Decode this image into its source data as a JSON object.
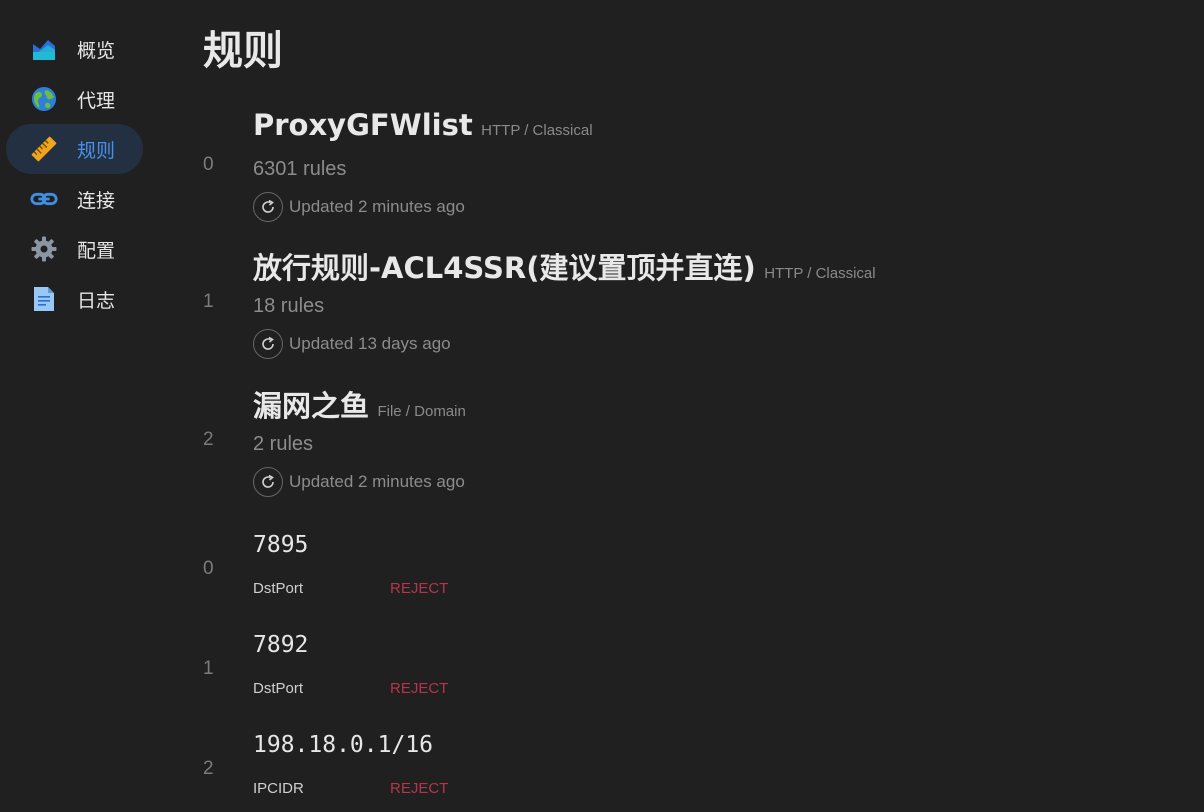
{
  "sidebar": {
    "items": [
      {
        "label": "概览",
        "icon": "overview-chart-icon",
        "active": false
      },
      {
        "label": "代理",
        "icon": "globe-icon",
        "active": false
      },
      {
        "label": "规则",
        "icon": "ruler-icon",
        "active": true
      },
      {
        "label": "连接",
        "icon": "link-icon",
        "active": false
      },
      {
        "label": "配置",
        "icon": "gear-icon",
        "active": false
      },
      {
        "label": "日志",
        "icon": "document-icon",
        "active": false
      }
    ]
  },
  "main": {
    "title": "规则",
    "providers": [
      {
        "index": "0",
        "name": "ProxyGFWlist",
        "type": "HTTP / Classical",
        "count": "6301 rules",
        "updated": "Updated 2 minutes ago"
      },
      {
        "index": "1",
        "name": "放行规则-ACL4SSR(建议置顶并直连)",
        "type": "HTTP / Classical",
        "count": "18 rules",
        "updated": "Updated 13 days ago"
      },
      {
        "index": "2",
        "name": "漏网之鱼",
        "type": "File / Domain",
        "count": "2 rules",
        "updated": "Updated 2 minutes ago"
      }
    ],
    "rules": [
      {
        "index": "0",
        "payload": "7895",
        "type": "DstPort",
        "policy": "REJECT"
      },
      {
        "index": "1",
        "payload": "7892",
        "type": "DstPort",
        "policy": "REJECT"
      },
      {
        "index": "2",
        "payload": "198.18.0.1/16",
        "type": "IPCIDR",
        "policy": "REJECT"
      }
    ]
  },
  "colors": {
    "background": "#202020",
    "active_bg": "#233041",
    "active_text": "#4a90e8",
    "reject": "#b5354c"
  }
}
